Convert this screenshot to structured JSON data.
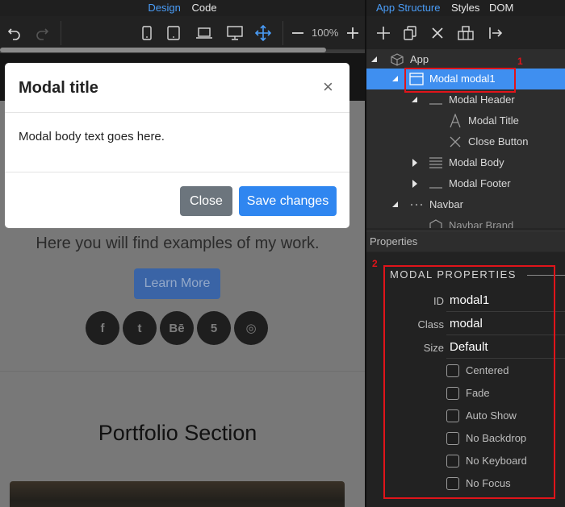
{
  "left_tabs": {
    "design": "Design",
    "code": "Code"
  },
  "toolbar": {
    "zoom": "100%"
  },
  "page": {
    "hero_text": "Here you will find examples of my work.",
    "learn_more": "Learn More",
    "social": [
      "f",
      "t",
      "Bē",
      "5",
      "◎"
    ],
    "portfolio_title": "Portfolio Section"
  },
  "modal": {
    "title": "Modal title",
    "close_glyph": "×",
    "body": "Modal body text goes here.",
    "close_btn": "Close",
    "save_btn": "Save changes"
  },
  "right_tabs": {
    "app_structure": "App Structure",
    "styles": "Styles",
    "dom": "DOM"
  },
  "tree": [
    {
      "label": "App"
    },
    {
      "label": "Modal modal1"
    },
    {
      "label": "Modal Header"
    },
    {
      "label": "Modal Title"
    },
    {
      "label": "Close Button"
    },
    {
      "label": "Modal Body"
    },
    {
      "label": "Modal Footer"
    },
    {
      "label": "Navbar"
    },
    {
      "label": "Navbar Brand"
    }
  ],
  "properties": {
    "header": "Properties",
    "section_title": "MODAL PROPERTIES",
    "id_label": "ID",
    "id_value": "modal1",
    "class_label": "Class",
    "class_value": "modal",
    "size_label": "Size",
    "size_value": "Default",
    "checkboxes": [
      "Centered",
      "Fade",
      "Auto Show",
      "No Backdrop",
      "No Keyboard",
      "No Focus"
    ]
  },
  "annotations": {
    "one": "1",
    "two": "2"
  },
  "colors": {
    "accent": "#4a9df8",
    "selected_row": "#3f8ff0",
    "annotation": "#e0141a",
    "primary_btn": "#2f86f0",
    "secondary_btn": "#6c757d"
  }
}
